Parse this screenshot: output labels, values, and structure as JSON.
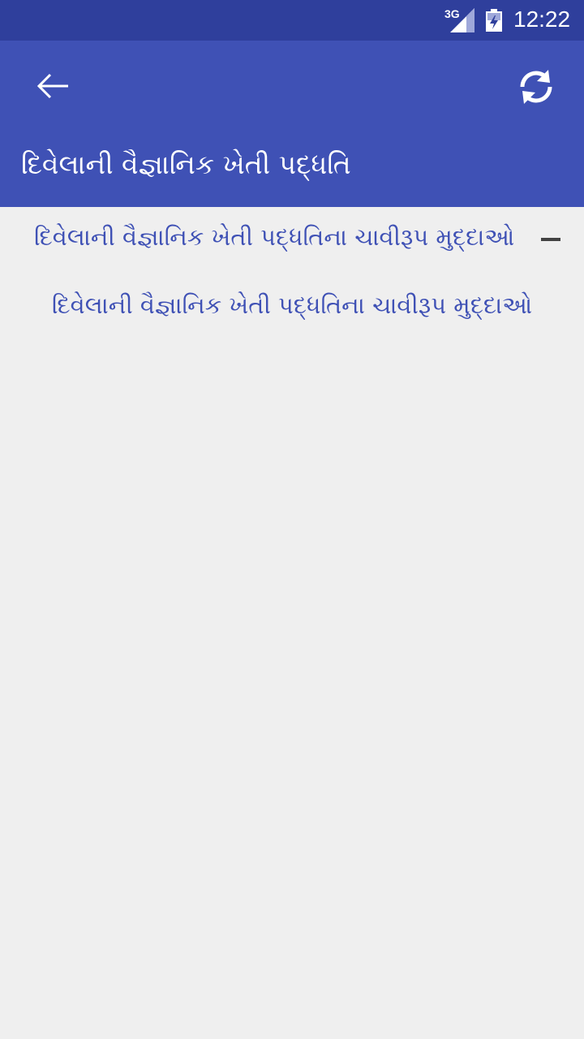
{
  "status_bar": {
    "network": "3G",
    "time": "12:22",
    "icons": [
      "signal-icon",
      "battery-icon"
    ],
    "color": "#2f3f9c"
  },
  "app_bar": {
    "title": "દિવેલાની વૈજ્ઞાનિક ખેતી પદ્ધતિ",
    "icons": [
      "back-arrow-icon",
      "refresh-icon"
    ],
    "color": "#3f51b5"
  },
  "list": {
    "group": {
      "label": "દિવેલાની વૈજ્ઞાનિક ખેતી પદ્ધતિના ચાવીરૂપ મુદ્દાઓ",
      "expanded": true,
      "icon": "minus-icon"
    },
    "children": [
      {
        "label": "દિવેલાની વૈજ્ઞાનિક ખેતી પદ્ધતિના ચાવીરૂપ મુદ્દાઓ"
      }
    ],
    "text_color": "#3f51b5"
  },
  "colors": {
    "background": "#efefef",
    "accent": "#3f51b5",
    "status": "#2f3f9c"
  }
}
